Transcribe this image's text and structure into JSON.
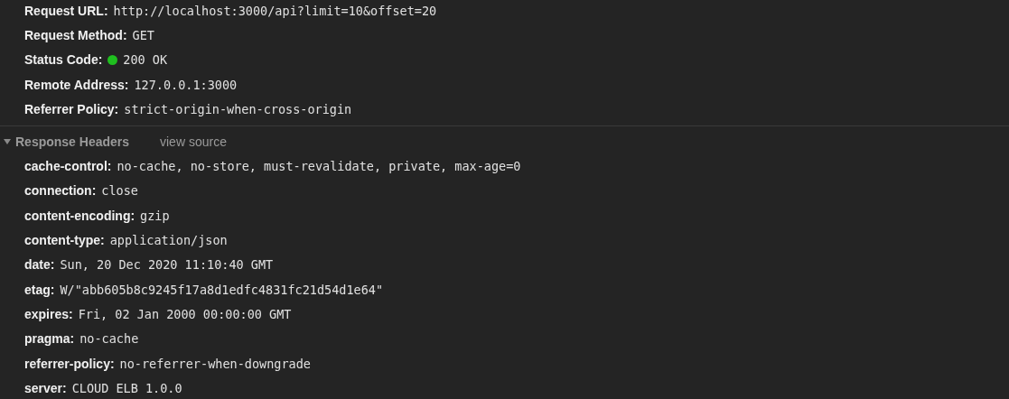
{
  "general": [
    {
      "label": "Request URL:",
      "value": "http://localhost:3000/api?limit=10&offset=20"
    },
    {
      "label": "Request Method:",
      "value": "GET"
    },
    {
      "label": "Status Code:",
      "value": "200 OK",
      "color": "#1fbf1f"
    },
    {
      "label": "Remote Address:",
      "value": "127.0.0.1:3000"
    },
    {
      "label": "Referrer Policy:",
      "value": "strict-origin-when-cross-origin"
    }
  ],
  "response_headers": {
    "title": "Response Headers",
    "expanded": true,
    "link": "view source",
    "rows": [
      {
        "label": "cache-control:",
        "value": "no-cache, no-store, must-revalidate, private, max-age=0"
      },
      {
        "label": "connection:",
        "value": "close"
      },
      {
        "label": "content-encoding:",
        "value": "gzip"
      },
      {
        "label": "content-type:",
        "value": "application/json"
      },
      {
        "label": "date:",
        "value": "Sun, 20 Dec 2020 11:10:40 GMT"
      },
      {
        "label": "etag:",
        "value": "W/\"abb605b8c9245f17a8d1edfc4831fc21d54d1e64\""
      },
      {
        "label": "expires:",
        "value": "Fri, 02 Jan 2000 00:00:00 GMT"
      },
      {
        "label": "pragma:",
        "value": "no-cache"
      },
      {
        "label": "referrer-policy:",
        "value": "no-referrer-when-downgrade"
      },
      {
        "label": "server:",
        "value": "CLOUD ELB 1.0.0"
      }
    ]
  }
}
